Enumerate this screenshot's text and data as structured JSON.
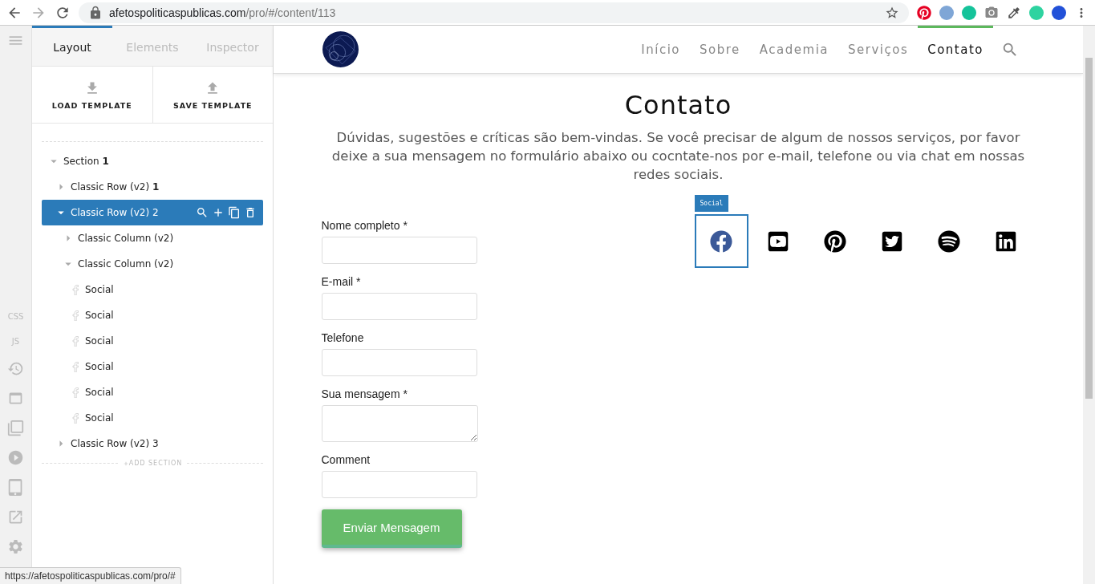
{
  "browser": {
    "url_host": "afetospoliticaspublicas.com",
    "url_path": "/pro/#/content/113",
    "status_url": "https://afetospoliticaspublicas.com/pro/#"
  },
  "rail": {
    "code_items": [
      "CSS",
      "JS"
    ]
  },
  "builder": {
    "tabs": [
      {
        "label": "Layout",
        "selected": true
      },
      {
        "label": "Elements",
        "selected": false
      },
      {
        "label": "Inspector",
        "selected": false
      }
    ],
    "template_buttons": [
      {
        "label": "LOAD TEMPLATE",
        "kind": "download"
      },
      {
        "label": "SAVE TEMPLATE",
        "kind": "upload"
      }
    ],
    "tree": [
      {
        "label": "Section **1**",
        "kind": "container",
        "expanded": true,
        "selected": false,
        "children": [
          {
            "label": "Classic Row (v2) **1**",
            "kind": "container",
            "expanded": false,
            "selected": false
          },
          {
            "label": "Classic Row (v2) 2",
            "kind": "container",
            "expanded": true,
            "selected": true,
            "children": [
              {
                "label": "Classic Column (v2)",
                "kind": "container",
                "expanded": false,
                "selected": false
              },
              {
                "label": "Classic Column (v2)",
                "kind": "container",
                "expanded": true,
                "selected": false,
                "children": [
                  {
                    "label": "Social",
                    "kind": "element",
                    "selected": false
                  },
                  {
                    "label": "Social",
                    "kind": "element",
                    "selected": false
                  },
                  {
                    "label": "Social",
                    "kind": "element",
                    "selected": false
                  },
                  {
                    "label": "Social",
                    "kind": "element",
                    "selected": false
                  },
                  {
                    "label": "Social",
                    "kind": "element",
                    "selected": false
                  },
                  {
                    "label": "Social",
                    "kind": "element",
                    "selected": false
                  }
                ]
              }
            ]
          },
          {
            "label": "Classic Row (v2) 3",
            "kind": "container",
            "expanded": false,
            "selected": false
          }
        ]
      }
    ],
    "add_section": "ADD SECTION"
  },
  "site": {
    "nav": [
      {
        "label": "Início",
        "selected": false
      },
      {
        "label": "Sobre",
        "selected": false
      },
      {
        "label": "Academia",
        "selected": false
      },
      {
        "label": "Serviços",
        "selected": false
      },
      {
        "label": "Contato",
        "selected": true
      }
    ],
    "title": "Contato",
    "intro": "Dúvidas, sugestões e críticas são bem-vindas. Se você precisar de algum de nossos serviços, por favor deixe a sua mensagem no formulário abaixo ou cocntate-nos por e-mail, telefone ou via chat em nossas redes sociais.",
    "form": {
      "fields": [
        {
          "label": "Nome completo *",
          "kind": "input"
        },
        {
          "label": "E-mail *",
          "kind": "input"
        },
        {
          "label": "Telefone",
          "kind": "input"
        },
        {
          "label": "Sua mensagem *",
          "kind": "textarea"
        },
        {
          "label": "Comment",
          "kind": "input"
        }
      ],
      "submit": "Enviar Mensagem"
    },
    "social": {
      "tag": "Social",
      "icons": [
        {
          "kind": "facebook",
          "selected": true
        },
        {
          "kind": "youtube",
          "selected": false
        },
        {
          "kind": "pinterest",
          "selected": false
        },
        {
          "kind": "twitter",
          "selected": false
        },
        {
          "kind": "spotify",
          "selected": false
        },
        {
          "kind": "linkedin",
          "selected": false
        }
      ]
    }
  }
}
